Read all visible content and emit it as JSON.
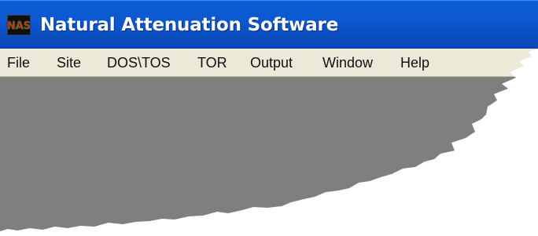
{
  "window": {
    "title": "Natural Attenuation Software",
    "logo_text": "NAS"
  },
  "menubar": {
    "items": [
      {
        "label": "File"
      },
      {
        "label": "Site"
      },
      {
        "label": "DOS\\TOS"
      },
      {
        "label": "TOR"
      },
      {
        "label": "Output"
      },
      {
        "label": "Window"
      },
      {
        "label": "Help"
      }
    ]
  },
  "colors": {
    "titlebar": "#0b58d0",
    "menubar": "#ece9d8",
    "client_area": "#808080"
  }
}
